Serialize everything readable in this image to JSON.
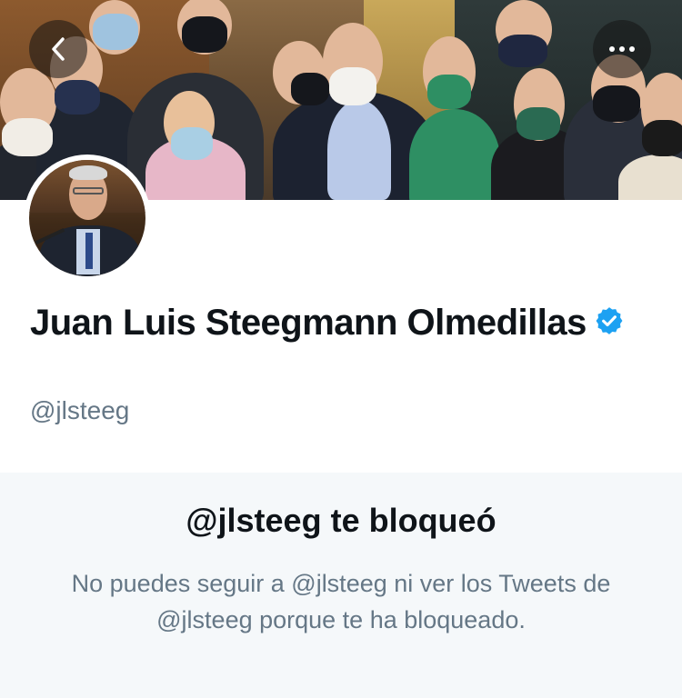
{
  "profile": {
    "display_name": "Juan Luis Steegmann Olmedillas",
    "handle": "@jlsteeg",
    "verified": true
  },
  "header": {
    "back_icon": "chevron-left-icon",
    "more_icon": "more-horizontal-icon"
  },
  "blocked": {
    "title": "@jlsteeg te bloqueó",
    "description": "No puedes seguir a @jlsteeg ni ver los Tweets de @jlsteeg porque te ha bloqueado."
  },
  "colors": {
    "verified": "#1da1f2",
    "text_primary": "#0f1419",
    "text_secondary": "#657786",
    "panel_bg": "#f5f8fa"
  }
}
